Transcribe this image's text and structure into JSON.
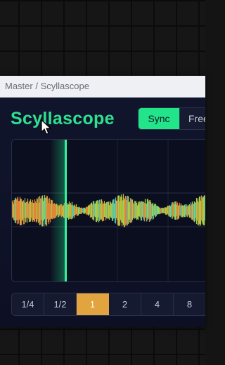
{
  "window": {
    "title": "Master / Scyllascope"
  },
  "plugin": {
    "name": "Scyllascope"
  },
  "mode_toggle": {
    "options": [
      "Sync",
      "Free"
    ],
    "selected": "Sync"
  },
  "division_bar": {
    "options": [
      "1/4",
      "1/2",
      "1",
      "2",
      "4",
      "8"
    ],
    "selected": "1"
  },
  "colors": {
    "accent_green": "#22e58a",
    "title_green": "#2ee08f",
    "selected_division": "#e2a43e",
    "panel_background": "#0e1226",
    "waveform_low": "#e98a3a",
    "waveform_mid": "#a8d94a",
    "waveform_high": "#4fc7c0"
  },
  "icons": {
    "cursor": "mouse-pointer-icon"
  }
}
